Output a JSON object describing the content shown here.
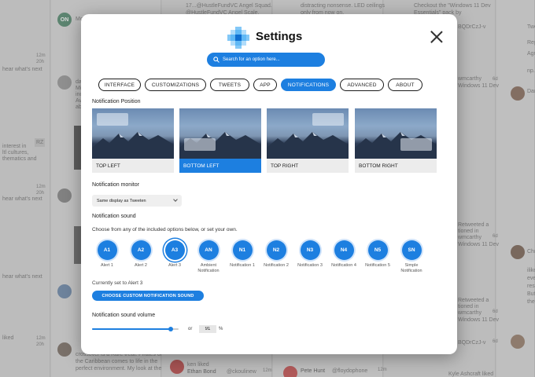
{
  "app": {
    "title": "Settings",
    "search_placeholder": "Search for an option here...",
    "accent": "#1d7fe0"
  },
  "tabs": [
    {
      "label": "INTERFACE",
      "active": false
    },
    {
      "label": "CUSTOMIZATIONS",
      "active": false
    },
    {
      "label": "TWEETS",
      "active": false
    },
    {
      "label": "APP",
      "active": false
    },
    {
      "label": "NOTIFICATIONS",
      "active": true
    },
    {
      "label": "ADVANCED",
      "active": false
    },
    {
      "label": "ABOUT",
      "active": false
    }
  ],
  "notification_position": {
    "heading": "Notification Position",
    "options": [
      {
        "label": "TOP LEFT",
        "selected": false
      },
      {
        "label": "BOTTOM LEFT",
        "selected": true
      },
      {
        "label": "TOP RIGHT",
        "selected": false
      },
      {
        "label": "BOTTOM RIGHT",
        "selected": false
      }
    ]
  },
  "notification_monitor": {
    "heading": "Notification monitor",
    "value": "Same display as Tweeten"
  },
  "notification_sound": {
    "heading": "Notification sound",
    "description": "Choose from any of the included options below, or set your own.",
    "options": [
      {
        "code": "A1",
        "label": "Alert 1"
      },
      {
        "code": "A2",
        "label": "Alert 2"
      },
      {
        "code": "A3",
        "label": "Alert 3",
        "selected": true
      },
      {
        "code": "AN",
        "label": "Ambient Notification"
      },
      {
        "code": "N1",
        "label": "Notification 1"
      },
      {
        "code": "N2",
        "label": "Notification 2"
      },
      {
        "code": "N3",
        "label": "Notification 3"
      },
      {
        "code": "N4",
        "label": "Notification 4"
      },
      {
        "code": "N5",
        "label": "Notification 5"
      },
      {
        "code": "SN",
        "label": "Simple Notification"
      }
    ],
    "current": "Currently set to Alert 3",
    "custom_button": "CHOOSE CUSTOM NOTIFICATION SOUND"
  },
  "volume": {
    "heading": "Notification sound volume",
    "or_label": "or",
    "value": "91",
    "fraction": 0.91,
    "unit": "%"
  },
  "background": {
    "left_texts": [
      "Mc",
      "da",
      "Mic",
      "ind",
      "Ava",
      "abo",
      "hear what's next",
      "interest in",
      "ltl cultures,",
      "thematics and",
      "hear what's next",
      "hear what's next",
      "liked"
    ],
    "left_times": [
      "12m",
      "20h",
      "12m",
      "20h",
      "12m",
      "20h"
    ],
    "badge": "RZ",
    "av_initials": "ON",
    "mid_texts": [
      "17...@HustleFundVC Angel Squad.",
      "@HustleFundVC Angel Scale.",
      "Ethan Bond",
      "@ckoulinew",
      "Pete Hunt",
      "@floydophone",
      "ken liked",
      "crossover is a Rare treat. Pirates of",
      "the Caribbean comes to life in the",
      "perfect environment. My look at the"
    ],
    "mid_times": [
      "12m",
      "12m"
    ],
    "right_texts": [
      "distracting nonsense. LED ceilings",
      "only from now on.",
      "Checkout the \"Windows 11 Dev",
      "Essentials\" pack by",
      "Retweeted a",
      "tioned in",
      "wmcarthy",
      "Windows 11 Dev",
      "Retweeted a",
      "tioned in",
      "wmcarthy",
      "Windows 11 Dev",
      "Retweeted a",
      "tioned in",
      "wmcarthy",
      "Windows 11 Dev",
      "Kyle Ashcraft liked"
    ],
    "right_codes": [
      "BQDrCzJ-v",
      "BQDrCzJ-v",
      "BQDrCzJ-v",
      "BQDrCzJ-v"
    ],
    "right_times": [
      "6d",
      "6d",
      "6d",
      "6d",
      "6d"
    ],
    "far_right": [
      "Twe",
      "Rep",
      "Agre",
      "np...",
      "Dan",
      "Chr",
      "ilike",
      "eve",
      "rese",
      "But",
      "the",
      "Twe",
      "Rep",
      "Chr",
      "ilike",
      "Rep"
    ]
  }
}
